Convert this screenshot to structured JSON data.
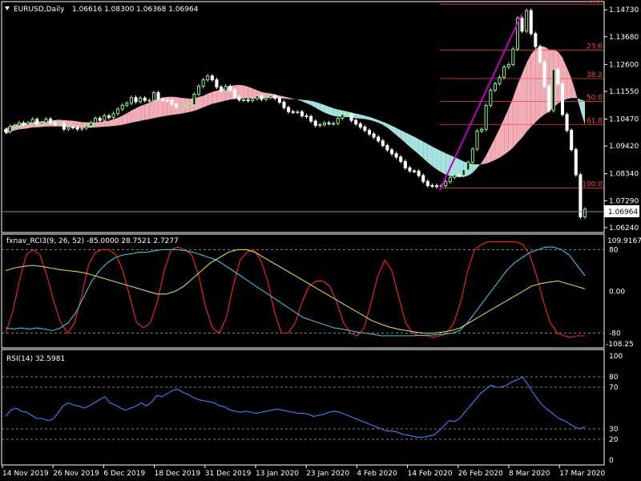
{
  "header": {
    "symbol": "EURUSD,Daily",
    "ohlc": "1.06616 1.08300 1.06368 1.06964"
  },
  "colors": {
    "background": "#000000",
    "grid_frame": "#ffffff",
    "bull_candle": "#90ee90",
    "bear_candle": "#ffffff",
    "ichimoku_bull_cloud": "#ffb6c1",
    "ichimoku_bear_cloud": "#afeeee",
    "fibo": "#ff4444",
    "trend_line": "#c000c0",
    "rci_short": "#ff2222",
    "rci_mid": "#40c0e0",
    "rci_long": "#d8d840",
    "rsi": "#4080ff"
  },
  "price_axis": {
    "ticks": [
      "1.14730",
      "1.13680",
      "1.12600",
      "1.11550",
      "1.10470",
      "1.09420",
      "1.08340",
      "1.07290",
      "1.06240"
    ],
    "current_price": "1.06964"
  },
  "fibonacci": {
    "levels": [
      {
        "label": "0.0",
        "price": 1.1495
      },
      {
        "label": "23.6",
        "price": 1.1316
      },
      {
        "label": "38.2",
        "price": 1.1205
      },
      {
        "label": "50.0",
        "price": 1.1116
      },
      {
        "label": "61.8",
        "price": 1.1026
      },
      {
        "label": "100.0",
        "price": 1.0778
      }
    ]
  },
  "indicator_rci": {
    "title": "fxnav_RCI3(9, 26, 52) -85.0000 28.7521 2.7277",
    "axis_top": "109.9167",
    "axis_bottom": "-108.25",
    "ticks": [
      "80",
      "0.00",
      "-80"
    ]
  },
  "indicator_rsi": {
    "title": "RSI(14) 32.5981",
    "ticks": [
      "100",
      "80",
      "70",
      "30",
      "20",
      "0"
    ]
  },
  "time_axis": {
    "labels": [
      "14 Nov 2019",
      "26 Nov 2019",
      "6 Dec 2019",
      "18 Dec 2019",
      "31 Dec 2019",
      "13 Jan 2020",
      "23 Jan 2020",
      "4 Feb 2020",
      "14 Feb 2020",
      "26 Feb 2020",
      "8 Mar 2020",
      "17 Mar 2020"
    ]
  },
  "chart_data": [
    {
      "type": "candlestick",
      "title": "EURUSD,Daily",
      "ylim": [
        1.0605,
        1.1505
      ],
      "open": [
        1.1005,
        1.0998,
        1.1018,
        1.1022,
        1.1032,
        1.1025,
        1.1032,
        1.1046,
        1.1028,
        1.1033,
        1.1047,
        1.1033,
        1.1027,
        1.103,
        1.1008,
        1.1016,
        1.1014,
        1.1008,
        1.1012,
        1.102,
        1.1032,
        1.105,
        1.1042,
        1.106,
        1.1053,
        1.1068,
        1.1086,
        1.1101,
        1.1109,
        1.1131,
        1.1115,
        1.1129,
        1.112,
        1.112,
        1.115,
        1.1125,
        1.1121,
        1.112,
        1.1105,
        1.1095,
        1.1096,
        1.1099,
        1.1103,
        1.1144,
        1.1175,
        1.12,
        1.1215,
        1.12,
        1.1172,
        1.1158,
        1.1175,
        1.116,
        1.1133,
        1.1122,
        1.1122,
        1.1119,
        1.1127,
        1.1137,
        1.1124,
        1.1131,
        1.1137,
        1.1128,
        1.1113,
        1.1092,
        1.1076,
        1.1075,
        1.1075,
        1.106,
        1.1057,
        1.1039,
        1.1022,
        1.1025,
        1.1032,
        1.103,
        1.103,
        1.105,
        1.1065,
        1.1065,
        1.1042,
        1.1028,
        1.1016,
        1.1003,
        1.0989,
        1.0977,
        1.0962,
        1.0944,
        1.0927,
        1.0912,
        1.0899,
        1.0882,
        1.0857,
        1.0845,
        1.0844,
        1.0827,
        1.0804,
        1.0788,
        1.0787,
        1.0784,
        1.0787,
        1.0803,
        1.082,
        1.0829,
        1.0828,
        1.0849,
        1.0879,
        1.093,
        1.1,
        1.1007,
        1.11,
        1.116,
        1.1185,
        1.121,
        1.125,
        1.126,
        1.132,
        1.144,
        1.139,
        1.147,
        1.138,
        1.133,
        1.127,
        1.1175,
        1.108,
        1.124,
        1.1185,
        1.1065,
        1.1003,
        1.0928,
        1.083,
        1.0666
      ],
      "close": [
        1.0998,
        1.1018,
        1.1022,
        1.1032,
        1.1025,
        1.1032,
        1.1046,
        1.1028,
        1.1033,
        1.1047,
        1.1033,
        1.1027,
        1.103,
        1.1008,
        1.1016,
        1.1014,
        1.1008,
        1.1012,
        1.102,
        1.1032,
        1.105,
        1.1042,
        1.106,
        1.1053,
        1.1068,
        1.1086,
        1.1101,
        1.1109,
        1.1131,
        1.1115,
        1.1129,
        1.112,
        1.112,
        1.115,
        1.1125,
        1.1121,
        1.112,
        1.1105,
        1.1095,
        1.1096,
        1.1099,
        1.1103,
        1.1144,
        1.1175,
        1.12,
        1.1215,
        1.12,
        1.1172,
        1.1158,
        1.1175,
        1.116,
        1.1133,
        1.1122,
        1.1122,
        1.1119,
        1.1127,
        1.1137,
        1.1124,
        1.1131,
        1.1137,
        1.1128,
        1.1113,
        1.1092,
        1.1076,
        1.1075,
        1.1075,
        1.106,
        1.1057,
        1.1039,
        1.1022,
        1.1025,
        1.1032,
        1.103,
        1.103,
        1.105,
        1.1065,
        1.1065,
        1.1042,
        1.1028,
        1.1016,
        1.1003,
        1.0989,
        1.0977,
        1.0962,
        1.0944,
        1.0927,
        1.0912,
        1.0899,
        1.0882,
        1.0857,
        1.0845,
        1.0844,
        1.0827,
        1.0804,
        1.0788,
        1.0787,
        1.0784,
        1.0787,
        1.0803,
        1.082,
        1.0829,
        1.0828,
        1.0849,
        1.0879,
        1.093,
        1.1,
        1.1007,
        1.11,
        1.116,
        1.1185,
        1.121,
        1.125,
        1.126,
        1.132,
        1.144,
        1.139,
        1.147,
        1.138,
        1.133,
        1.127,
        1.1175,
        1.108,
        1.124,
        1.1185,
        1.1065,
        1.1003,
        1.0928,
        1.083,
        1.0666,
        1.0696
      ],
      "current": 1.06964
    },
    {
      "type": "line",
      "title": "fxnav_RCI3(9, 26, 52) -85.0000 28.7521 2.7277",
      "ylim": [
        -108.25,
        109.9167
      ],
      "reference_lines": [
        80,
        0,
        -80
      ],
      "series": [
        {
          "values": [
            -80,
            -40,
            20,
            70,
            80,
            70,
            30,
            -20,
            -60,
            -80,
            -60,
            -10,
            50,
            75,
            80,
            80,
            70,
            40,
            -10,
            -60,
            -70,
            -60,
            -20,
            40,
            80,
            85,
            80,
            70,
            30,
            -30,
            -70,
            -80,
            -50,
            10,
            60,
            75,
            80,
            60,
            20,
            -40,
            -80,
            -80,
            -60,
            -20,
            10,
            20,
            20,
            10,
            -20,
            -60,
            -80,
            -85,
            -70,
            -20,
            30,
            60,
            40,
            -10,
            -60,
            -80,
            -85,
            -85,
            -88,
            -85,
            -80,
            -60,
            -20,
            40,
            80,
            90,
            95,
            95,
            95,
            95,
            95,
            90,
            70,
            30,
            -20,
            -60,
            -80,
            -85,
            -88,
            -85,
            -85
          ]
        },
        {
          "values": [
            -70,
            -72,
            -70,
            -72,
            -70,
            -72,
            -75,
            -70,
            -60,
            -40,
            -10,
            20,
            40,
            55,
            65,
            70,
            72,
            75,
            75,
            78,
            80,
            80,
            80,
            78,
            75,
            70,
            65,
            60,
            50,
            40,
            30,
            20,
            10,
            0,
            -10,
            -20,
            -30,
            -40,
            -50,
            -55,
            -60,
            -65,
            -70,
            -72,
            -75,
            -78,
            -80,
            -82,
            -85,
            -85,
            -85,
            -85,
            -85,
            -84,
            -84,
            -83,
            -82,
            -80,
            -75,
            -60,
            -40,
            -20,
            0,
            20,
            40,
            55,
            65,
            75,
            80,
            85,
            85,
            80,
            70,
            50,
            30
          ]
        },
        {
          "values": [
            40,
            45,
            48,
            50,
            48,
            45,
            42,
            40,
            38,
            35,
            30,
            25,
            20,
            15,
            10,
            5,
            0,
            -5,
            -5,
            0,
            10,
            25,
            40,
            55,
            65,
            75,
            80,
            80,
            75,
            65,
            55,
            45,
            35,
            25,
            15,
            5,
            -5,
            -15,
            -25,
            -35,
            -45,
            -55,
            -62,
            -68,
            -72,
            -75,
            -78,
            -80,
            -80,
            -78,
            -75,
            -70,
            -60,
            -50,
            -40,
            -30,
            -20,
            -10,
            0,
            10,
            15,
            18,
            20,
            15,
            10,
            5
          ]
        }
      ]
    },
    {
      "type": "line",
      "title": "RSI(14) 32.5981",
      "ylim": [
        0,
        100
      ],
      "reference_lines": [
        80,
        70,
        30,
        20
      ],
      "series": [
        {
          "values": [
            42,
            48,
            50,
            47,
            46,
            43,
            40,
            40,
            38,
            39,
            45,
            52,
            55,
            53,
            52,
            50,
            52,
            55,
            58,
            61,
            55,
            53,
            50,
            48,
            50,
            52,
            55,
            52,
            56,
            62,
            61,
            64,
            67,
            68,
            65,
            63,
            60,
            58,
            57,
            56,
            55,
            52,
            51,
            48,
            47,
            46,
            47,
            46,
            45,
            46,
            47,
            48,
            49,
            48,
            47,
            46,
            45,
            45,
            44,
            42,
            43,
            44,
            46,
            47,
            46,
            44,
            42,
            40,
            38,
            36,
            34,
            32,
            30,
            28,
            28,
            27,
            25,
            24,
            23,
            22,
            22,
            23,
            24,
            28,
            33,
            38,
            37,
            40,
            46,
            52,
            58,
            64,
            68,
            72,
            70,
            70,
            72,
            75,
            77,
            80,
            73,
            65,
            58,
            52,
            48,
            44,
            40,
            38,
            35,
            32,
            30,
            32
          ]
        }
      ]
    }
  ]
}
